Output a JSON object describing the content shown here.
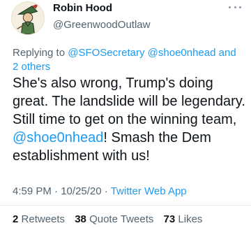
{
  "author": {
    "name": "Robin Hood",
    "handle": "@GreenwoodOutlaw"
  },
  "reply": {
    "prefix": "Replying to",
    "mention1": "@SFOSecretary",
    "mention2": "@shoe0nhead",
    "suffix_and": "and",
    "suffix_others": "2 others"
  },
  "tweet": {
    "text_part1": "She's also wrong, Trump's doing great. The landslide will be legendary. Still time to get on the winning team, ",
    "mention": "@shoe0nhead",
    "text_part2": "! Smash the Dem establishment with us!"
  },
  "meta": {
    "time": "4:59 PM",
    "date": "10/25/20",
    "app": "Twitter Web App"
  },
  "stats": {
    "retweets_count": "2",
    "retweets_label": "Retweets",
    "quotes_count": "38",
    "quotes_label": "Quote Tweets",
    "likes_count": "73",
    "likes_label": "Likes"
  },
  "icons": {
    "avatar": "robin-hood-avatar",
    "more": "more-icon"
  },
  "colors": {
    "link": "#1d9bf0",
    "secondary_text": "#536471",
    "primary_text": "#0f1419"
  }
}
